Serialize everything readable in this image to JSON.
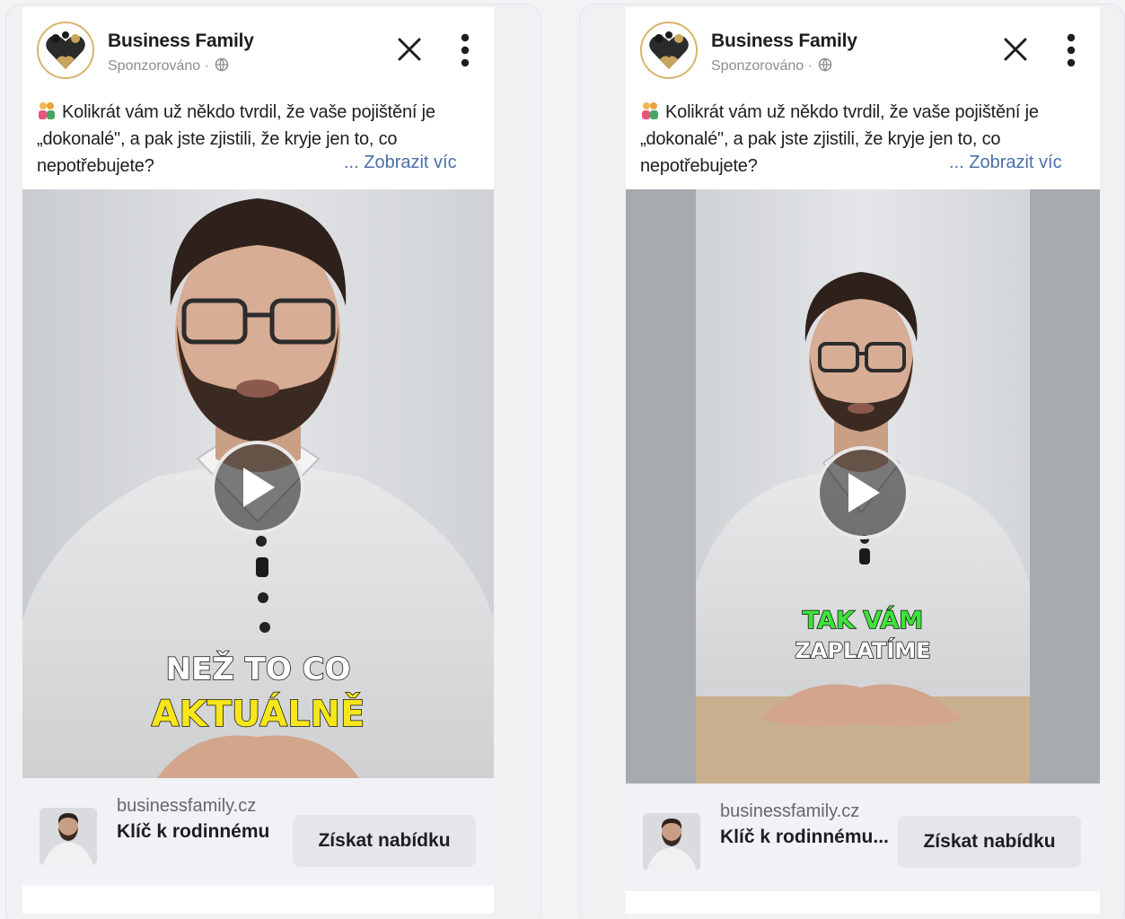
{
  "ads": [
    {
      "page_name": "Business Family",
      "sponsored_label": "Sponzorováno ·",
      "caption": "Kolikrát vám už někdo tvrdil, že vaše pojištění je „dokonalé\", a pak jste zjistili, že kryje jen to, co nepotřebujete?",
      "see_more": "... Zobrazit víc",
      "subtitle_line1": "NEŽ TO CO",
      "subtitle_line2": "AKTUÁLNĚ",
      "subtitle_line1_color": "#ffffff",
      "subtitle_line2_color": "#f6e61a",
      "domain": "businessfamily.cz",
      "ad_title": "Klíč k rodinnému",
      "cta": "Získat nabídku"
    },
    {
      "page_name": "Business Family",
      "sponsored_label": "Sponzorováno ·",
      "caption": "Kolikrát vám už někdo tvrdil, že vaše pojištění je „dokonalé\", a pak jste zjistili, že kryje jen to, co nepotřebujete?",
      "see_more": "... Zobrazit víc",
      "subtitle_line1": "TAK VÁM",
      "subtitle_line2": "ZAPLATÍME",
      "subtitle_line1_color": "#3ee23a",
      "subtitle_line2_color": "#ffffff",
      "domain": "businessfamily.cz",
      "ad_title": "Klíč k rodinnému...",
      "cta": "Získat nabídku"
    }
  ],
  "colors": {
    "link": "#4b6fa9",
    "brand_gold": "#d9b46a",
    "cta_bg": "#e4e6eb",
    "footer_bg": "#f0f2f5"
  },
  "icons": [
    "business-family-logo-icon",
    "globe-icon",
    "close-icon",
    "more-options-icon",
    "people-emoji-icon",
    "play-icon"
  ]
}
